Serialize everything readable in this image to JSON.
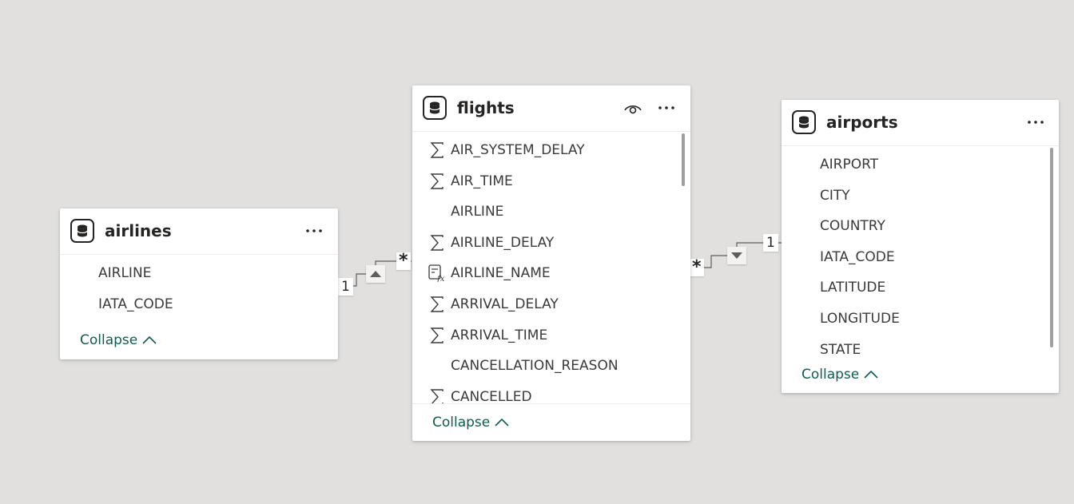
{
  "tables": {
    "airlines": {
      "title": "airlines",
      "fields": [
        {
          "name": "AIRLINE",
          "icon": "none"
        },
        {
          "name": "IATA_CODE",
          "icon": "none"
        }
      ],
      "collapse_label": "Collapse"
    },
    "flights": {
      "title": "flights",
      "fields": [
        {
          "name": "AIR_SYSTEM_DELAY",
          "icon": "sigma-icon"
        },
        {
          "name": "AIR_TIME",
          "icon": "sigma-icon"
        },
        {
          "name": "AIRLINE",
          "icon": "none"
        },
        {
          "name": "AIRLINE_DELAY",
          "icon": "sigma-icon"
        },
        {
          "name": "AIRLINE_NAME",
          "icon": "calculated-column-icon"
        },
        {
          "name": "ARRIVAL_DELAY",
          "icon": "sigma-icon"
        },
        {
          "name": "ARRIVAL_TIME",
          "icon": "sigma-icon"
        },
        {
          "name": "CANCELLATION_REASON",
          "icon": "none"
        },
        {
          "name": "CANCELLED",
          "icon": "sigma-icon"
        }
      ],
      "collapse_label": "Collapse"
    },
    "airports": {
      "title": "airports",
      "fields": [
        {
          "name": "AIRPORT",
          "icon": "none"
        },
        {
          "name": "CITY",
          "icon": "none"
        },
        {
          "name": "COUNTRY",
          "icon": "none"
        },
        {
          "name": "IATA_CODE",
          "icon": "none"
        },
        {
          "name": "LATITUDE",
          "icon": "none"
        },
        {
          "name": "LONGITUDE",
          "icon": "none"
        },
        {
          "name": "STATE",
          "icon": "none"
        }
      ],
      "collapse_label": "Collapse"
    }
  },
  "relationships": {
    "airlines_flights": {
      "one_side": "1",
      "many_side": "*"
    },
    "flights_airports": {
      "one_side": "1",
      "many_side": "*"
    }
  },
  "colors": {
    "canvas": "#e1e0df",
    "card": "#ffffff",
    "link": "#0f5b50",
    "text": "#252423"
  }
}
